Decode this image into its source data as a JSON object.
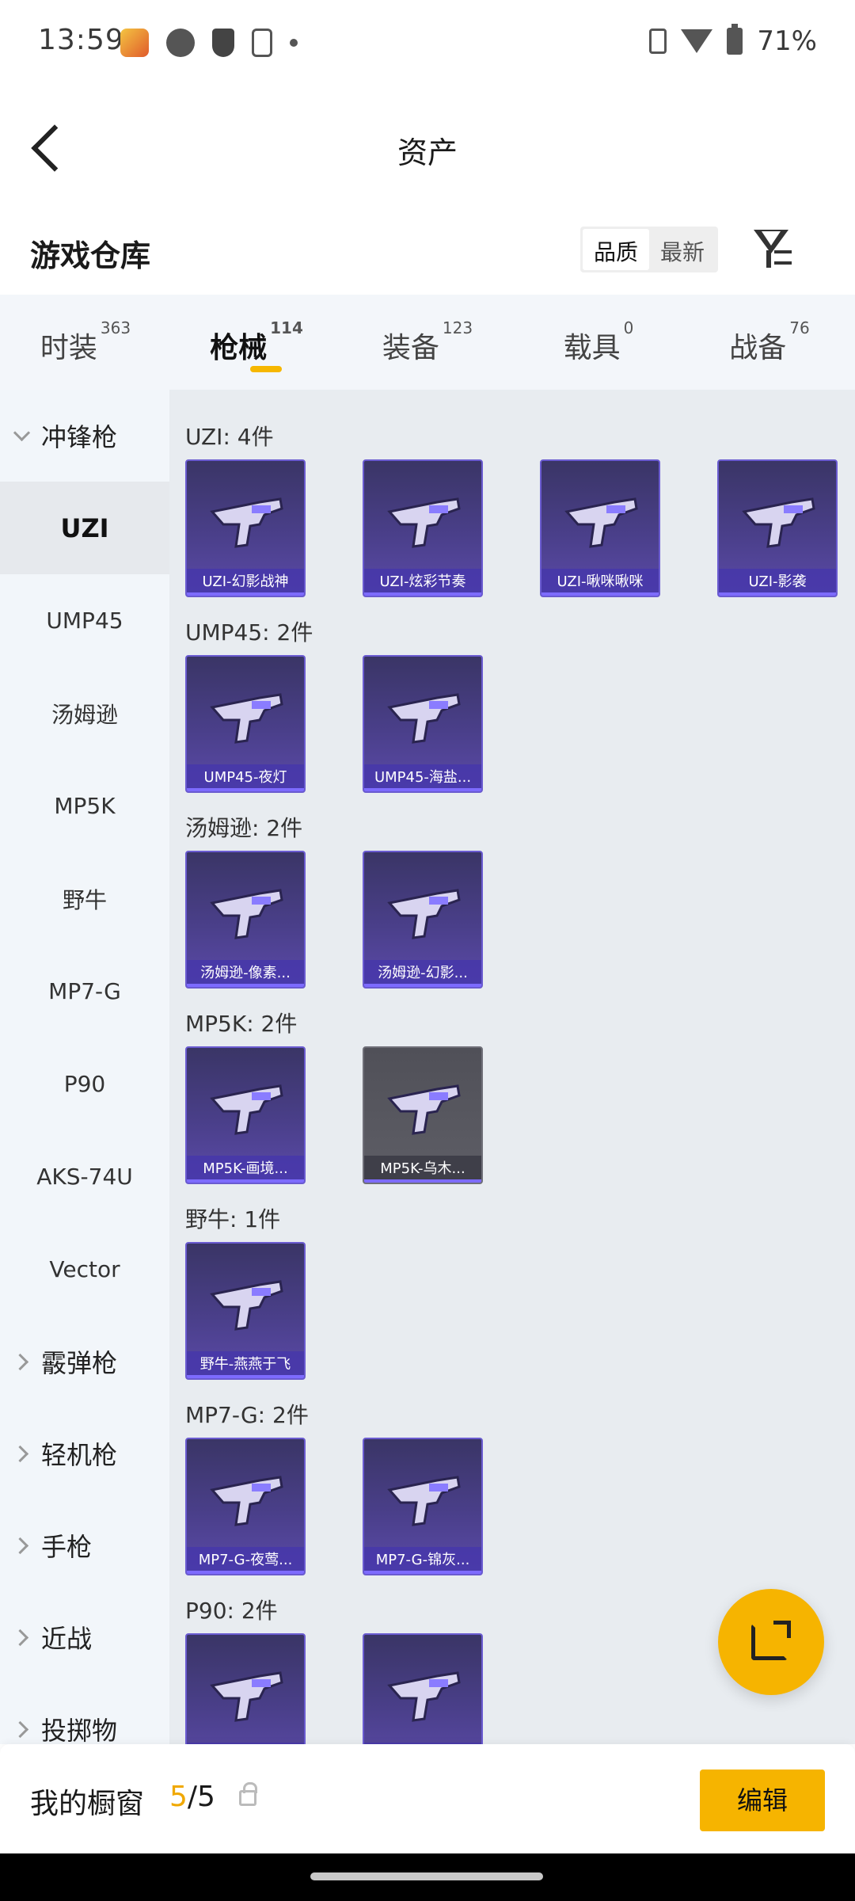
{
  "status": {
    "time": "13:59",
    "battery": "71%"
  },
  "header": {
    "title": "资产"
  },
  "section": {
    "title": "游戏仓库",
    "sort_options": [
      "品质",
      "最新"
    ],
    "active_sort": "品质"
  },
  "tabs": [
    {
      "label": "时装",
      "count": "363"
    },
    {
      "label": "枪械",
      "count": "114"
    },
    {
      "label": "装备",
      "count": "123"
    },
    {
      "label": "载具",
      "count": "0"
    },
    {
      "label": "战备",
      "count": "76"
    }
  ],
  "nav": {
    "group_open": "冲锋枪",
    "items": [
      "UZI",
      "UMP45",
      "汤姆逊",
      "MP5K",
      "野牛",
      "MP7-G",
      "P90",
      "AKS-74U",
      "Vector"
    ],
    "groups_closed": [
      "霰弹枪",
      "轻机枪",
      "手枪",
      "近战",
      "投掷物"
    ]
  },
  "groups": [
    {
      "label": "UZI: 4件",
      "cards": [
        "UZI-幻影战神",
        "UZI-炫彩节奏",
        "UZI-啾咪啾咪",
        "UZI-影袭"
      ]
    },
    {
      "label": "UMP45: 2件",
      "cards": [
        "UMP45-夜灯",
        "UMP45-海盐..."
      ]
    },
    {
      "label": "汤姆逊: 2件",
      "cards": [
        "汤姆逊-像素...",
        "汤姆逊-幻影..."
      ]
    },
    {
      "label": "MP5K: 2件",
      "cards": [
        "MP5K-画境...",
        "MP5K-乌木..."
      ]
    },
    {
      "label": "野牛: 1件",
      "cards": [
        "野牛-燕燕于飞"
      ]
    },
    {
      "label": "MP7-G: 2件",
      "cards": [
        "MP7-G-夜莺...",
        "MP7-G-锦灰..."
      ]
    },
    {
      "label": "P90: 2件",
      "cards": [
        "",
        ""
      ]
    }
  ],
  "bottom": {
    "label": "我的橱窗",
    "current": "5",
    "total": "/5",
    "edit": "编辑"
  },
  "colors": {
    "accent": "#f6b400",
    "card_purple": "#4a3f8a",
    "bg": "#e8ecf0"
  }
}
